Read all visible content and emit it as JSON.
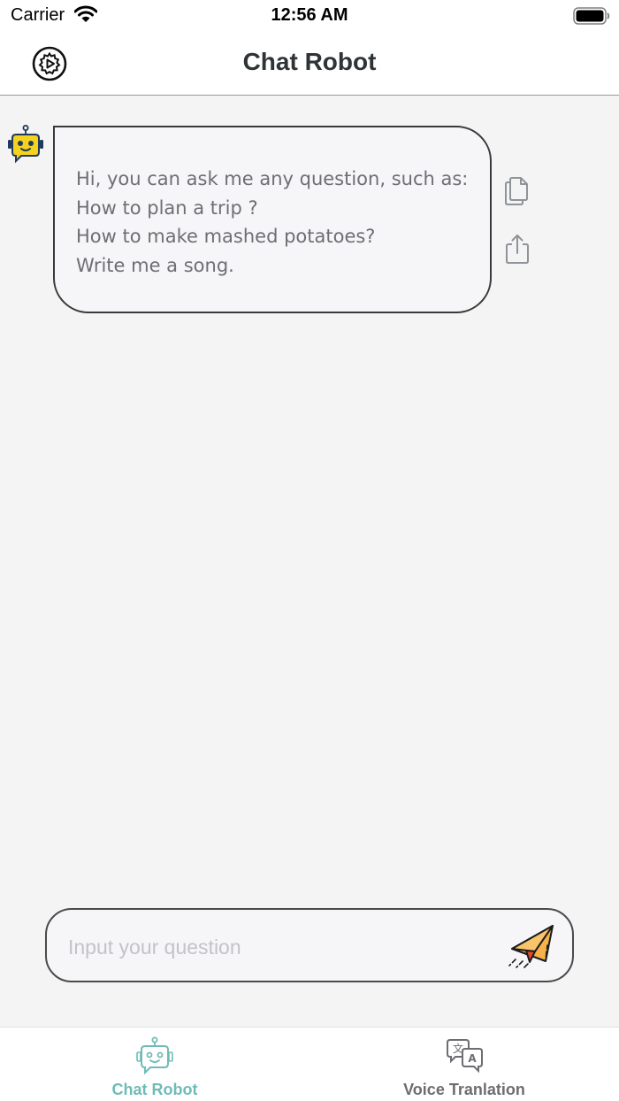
{
  "status_bar": {
    "carrier": "Carrier",
    "time": "12:56 AM",
    "wifi_icon": "wifi-icon",
    "battery_icon": "battery-icon"
  },
  "header": {
    "title": "Chat Robot",
    "settings_icon": "settings-gear-icon"
  },
  "chat": {
    "messages": [
      {
        "sender": "bot",
        "avatar_icon": "robot-avatar-icon",
        "lines": [
          "Hi, you can ask me any question, such as:",
          "How to plan a trip ?",
          "How to make mashed potatoes?",
          "Write me a song."
        ],
        "actions": [
          "copy-icon",
          "share-icon"
        ]
      }
    ]
  },
  "composer": {
    "placeholder": "Input your question",
    "value": "",
    "send_icon": "paper-plane-icon"
  },
  "tab_bar": {
    "tabs": [
      {
        "label": "Chat Robot",
        "icon": "chat-robot-icon",
        "active": true
      },
      {
        "label": "Voice Tranlation",
        "icon": "translate-icon",
        "active": false
      }
    ]
  },
  "colors": {
    "active_tab": "#6fbcb7",
    "inactive_tab": "#6d6d72",
    "bubble_bg": "#f6f6f9",
    "page_bg": "#f4f4f4",
    "avatar_yellow": "#f5d21f",
    "send_orange": "#f7b24a"
  }
}
